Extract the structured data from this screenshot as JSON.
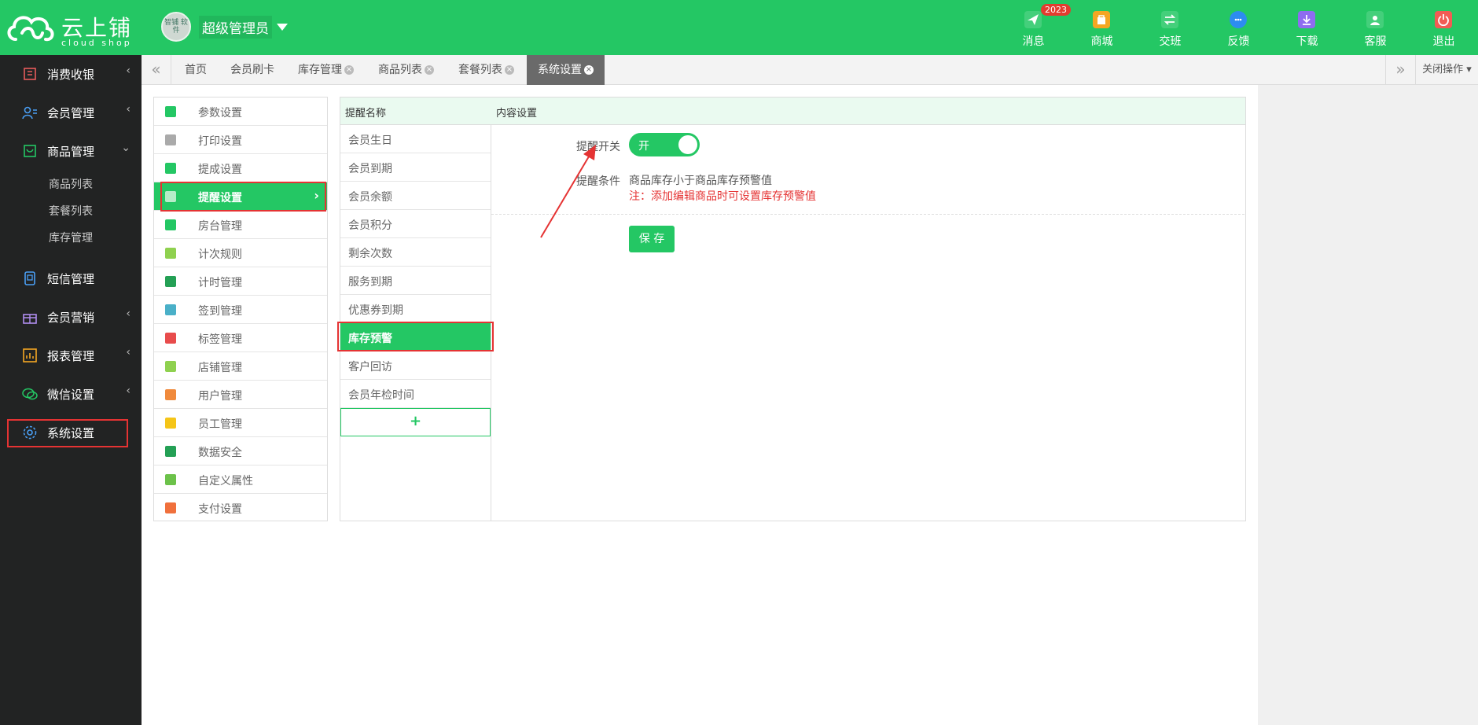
{
  "brand": {
    "name": "云上铺",
    "subtitle": "cloud shop"
  },
  "user": {
    "avatar_text": "智铺 软件",
    "name": "超级管理员"
  },
  "topnav": [
    {
      "label": "消息",
      "icon": "message-icon",
      "badge": "2023"
    },
    {
      "label": "商城",
      "icon": "mall-icon"
    },
    {
      "label": "交班",
      "icon": "shift-icon"
    },
    {
      "label": "反馈",
      "icon": "feedback-icon"
    },
    {
      "label": "下载",
      "icon": "download-icon"
    },
    {
      "label": "客服",
      "icon": "service-icon"
    },
    {
      "label": "退出",
      "icon": "logout-icon"
    }
  ],
  "sidebar": {
    "items": [
      {
        "label": "消费收银",
        "arrow": "‹"
      },
      {
        "label": "会员管理",
        "arrow": "‹"
      },
      {
        "label": "商品管理",
        "arrow": "⌄"
      },
      {
        "label": "短信管理",
        "arrow": ""
      },
      {
        "label": "会员营销",
        "arrow": "‹"
      },
      {
        "label": "报表管理",
        "arrow": "‹"
      },
      {
        "label": "微信设置",
        "arrow": "‹"
      },
      {
        "label": "系统设置",
        "arrow": ""
      }
    ],
    "subitems": [
      "商品列表",
      "套餐列表",
      "库存管理"
    ]
  },
  "tabs": {
    "items": [
      "首页",
      "会员刷卡",
      "库存管理",
      "商品列表",
      "套餐列表",
      "系统设置"
    ],
    "close_label": "关闭操作"
  },
  "settings_menu": [
    "参数设置",
    "打印设置",
    "提成设置",
    "提醒设置",
    "房台管理",
    "计次规则",
    "计时管理",
    "签到管理",
    "标签管理",
    "店铺管理",
    "用户管理",
    "员工管理",
    "数据安全",
    "自定义属性",
    "支付设置"
  ],
  "reminder": {
    "header_name": "提醒名称",
    "header_content": "内容设置",
    "items": [
      "会员生日",
      "会员到期",
      "会员余额",
      "会员积分",
      "剩余次数",
      "服务到期",
      "优惠券到期",
      "库存预警",
      "客户回访",
      "会员年检时间"
    ],
    "add_label": "+",
    "switch_label": "提醒开关",
    "switch_value": "开",
    "switch_on": true,
    "condition_label": "提醒条件",
    "condition_text": "商品库存小于商品库存预警值",
    "condition_note": "注：添加编辑商品时可设置库存预警值",
    "save_label": "保 存"
  },
  "colors": {
    "accent": "#24c764",
    "sidebar": "#222323",
    "highlight": "#e53333"
  }
}
